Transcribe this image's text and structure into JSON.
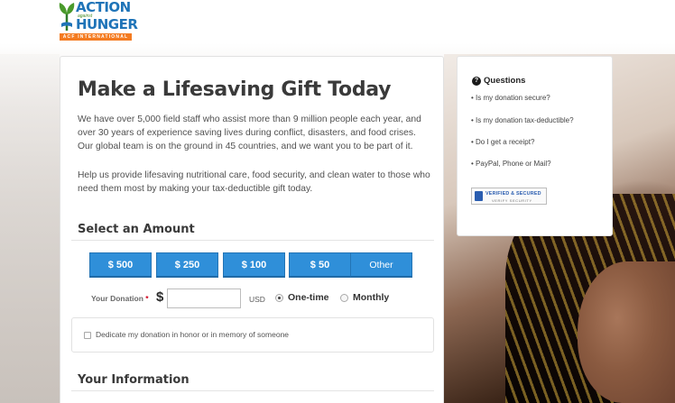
{
  "logo": {
    "line1": "ACTION",
    "small": "against",
    "line2": "HUNGER",
    "bar": "ACF INTERNATIONAL"
  },
  "main": {
    "title": "Make a Lifesaving Gift Today",
    "intro": "We have over 5,000 field staff who assist more than 9 million people each year, and over 30 years of experience saving lives during conflict, disasters, and food crises. Our global team is on the ground in 45 countries, and we want you to be part of it.",
    "help": "Help us provide lifesaving nutritional care, food security, and clean water to those who need them most by making your tax-deductible gift today."
  },
  "amount": {
    "heading": "Select an Amount",
    "buttons": [
      "$ 500",
      "$ 250",
      "$ 100",
      "$ 50",
      "Other"
    ],
    "donation_label": "Your Donation",
    "required_mark": "*",
    "currency_symbol": "$",
    "donation_value": "",
    "currency_code": "USD",
    "frequency": [
      {
        "label": "One-time",
        "selected": true
      },
      {
        "label": "Monthly",
        "selected": false
      }
    ],
    "dedicate_label": "Dedicate my donation in honor or in memory of someone",
    "dedicate_checked": false
  },
  "info": {
    "heading": "Your Information"
  },
  "questions": {
    "icon": "question-circle-icon",
    "title": "Questions",
    "items": [
      "Is my donation secure?",
      "Is my donation tax-deductible?",
      "Do I get a receipt?",
      "PayPal, Phone or Mail?"
    ],
    "badge_text": "VERIFIED & SECURED",
    "badge_sub": "VERIFY SECURITY"
  },
  "colors": {
    "accent": "#2f8fd9",
    "brand_blue": "#1f74b8",
    "brand_orange": "#f47b20",
    "required": "#d0021b"
  }
}
